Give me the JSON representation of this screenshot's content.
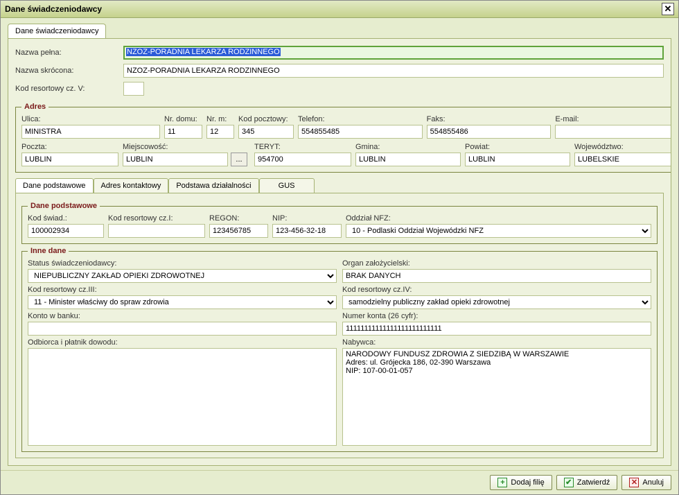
{
  "window": {
    "title": "Dane świadczeniodawcy"
  },
  "outerTab": "Dane świadczeniodawcy",
  "fields": {
    "nazwa_pelna_lbl": "Nazwa pełna:",
    "nazwa_pelna": "NZOZ-PORADNIA LEKARZA RODZINNEGO",
    "nazwa_skrocona_lbl": "Nazwa skrócona:",
    "nazwa_skrocona": "NZOZ-PORADNIA LEKARZA RODZINNEGO",
    "kod_resort_v_lbl": "Kod resortowy cz. V:",
    "kod_resort_v": ""
  },
  "adres": {
    "legend": "Adres",
    "ulica_lbl": "Ulica:",
    "ulica": "MINISTRA",
    "nr_domu_lbl": "Nr. domu:",
    "nr_domu": "11",
    "nr_m_lbl": "Nr. m:",
    "nr_m": "12",
    "kod_pocz_lbl": "Kod pocztowy:",
    "kod_pocz": "345",
    "telefon_lbl": "Telefon:",
    "telefon": "554855485",
    "faks_lbl": "Faks:",
    "faks": "554855486",
    "email_lbl": "E-mail:",
    "email": "",
    "poczta_lbl": "Poczta:",
    "poczta": "LUBLIN",
    "miejscowosc_lbl": "Miejscowość:",
    "miejscowosc": "LUBLIN",
    "teryt_lbl": "TERYT:",
    "teryt": "954700",
    "gmina_lbl": "Gmina:",
    "gmina": "LUBLIN",
    "powiat_lbl": "Powiat:",
    "powiat": "LUBLIN",
    "woj_lbl": "Województwo:",
    "woj": "LUBELSKIE",
    "browse": "..."
  },
  "innerTabs": {
    "t1": "Dane podstawowe",
    "t2": "Adres kontaktowy",
    "t3": "Podstawa działalności",
    "t4": "GUS"
  },
  "danePodst": {
    "legend": "Dane podstawowe",
    "kod_swiad_lbl": "Kod świad.:",
    "kod_swiad": "100002934",
    "kod_res1_lbl": "Kod resortowy cz.I:",
    "kod_res1": "",
    "regon_lbl": "REGON:",
    "regon": "123456785",
    "nip_lbl": "NIP:",
    "nip": "123-456-32-18",
    "oddzial_lbl": "Oddział NFZ:",
    "oddzial": "10 - Podlaski Oddział Wojewódzki NFZ"
  },
  "inne": {
    "legend": "Inne dane",
    "status_lbl": "Status świadczeniodawcy:",
    "status": "NIEPUBLICZNY ZAKŁAD OPIEKI ZDROWOTNEJ",
    "organ_lbl": "Organ założycielski:",
    "organ": "BRAK DANYCH",
    "kod_res3_lbl": "Kod resortowy cz.III:",
    "kod_res3": "11 - Minister właściwy do spraw zdrowia",
    "kod_res4_lbl": "Kod resortowy cz.IV:",
    "kod_res4": "samodzielny publiczny zakład opieki zdrowotnej",
    "konto_lbl": "Konto w banku:",
    "konto": "",
    "numer_konta_lbl": "Numer konta (26 cyfr):",
    "numer_konta": "11111111111111111111111111",
    "odbiorca_lbl": "Odbiorca i płatnik dowodu:",
    "odbiorca": "",
    "nabywca_lbl": "Nabywca:",
    "nabywca": "NARODOWY FUNDUSZ ZDROWIA Z SIEDZIBĄ W WARSZAWIE\nAdres: ul. Grójecka 186, 02-390 Warszawa\nNIP: 107-00-01-057"
  },
  "footer": {
    "dodaj": "Dodaj filię",
    "zatwierdz": "Zatwierdź",
    "anuluj": "Anuluj"
  }
}
